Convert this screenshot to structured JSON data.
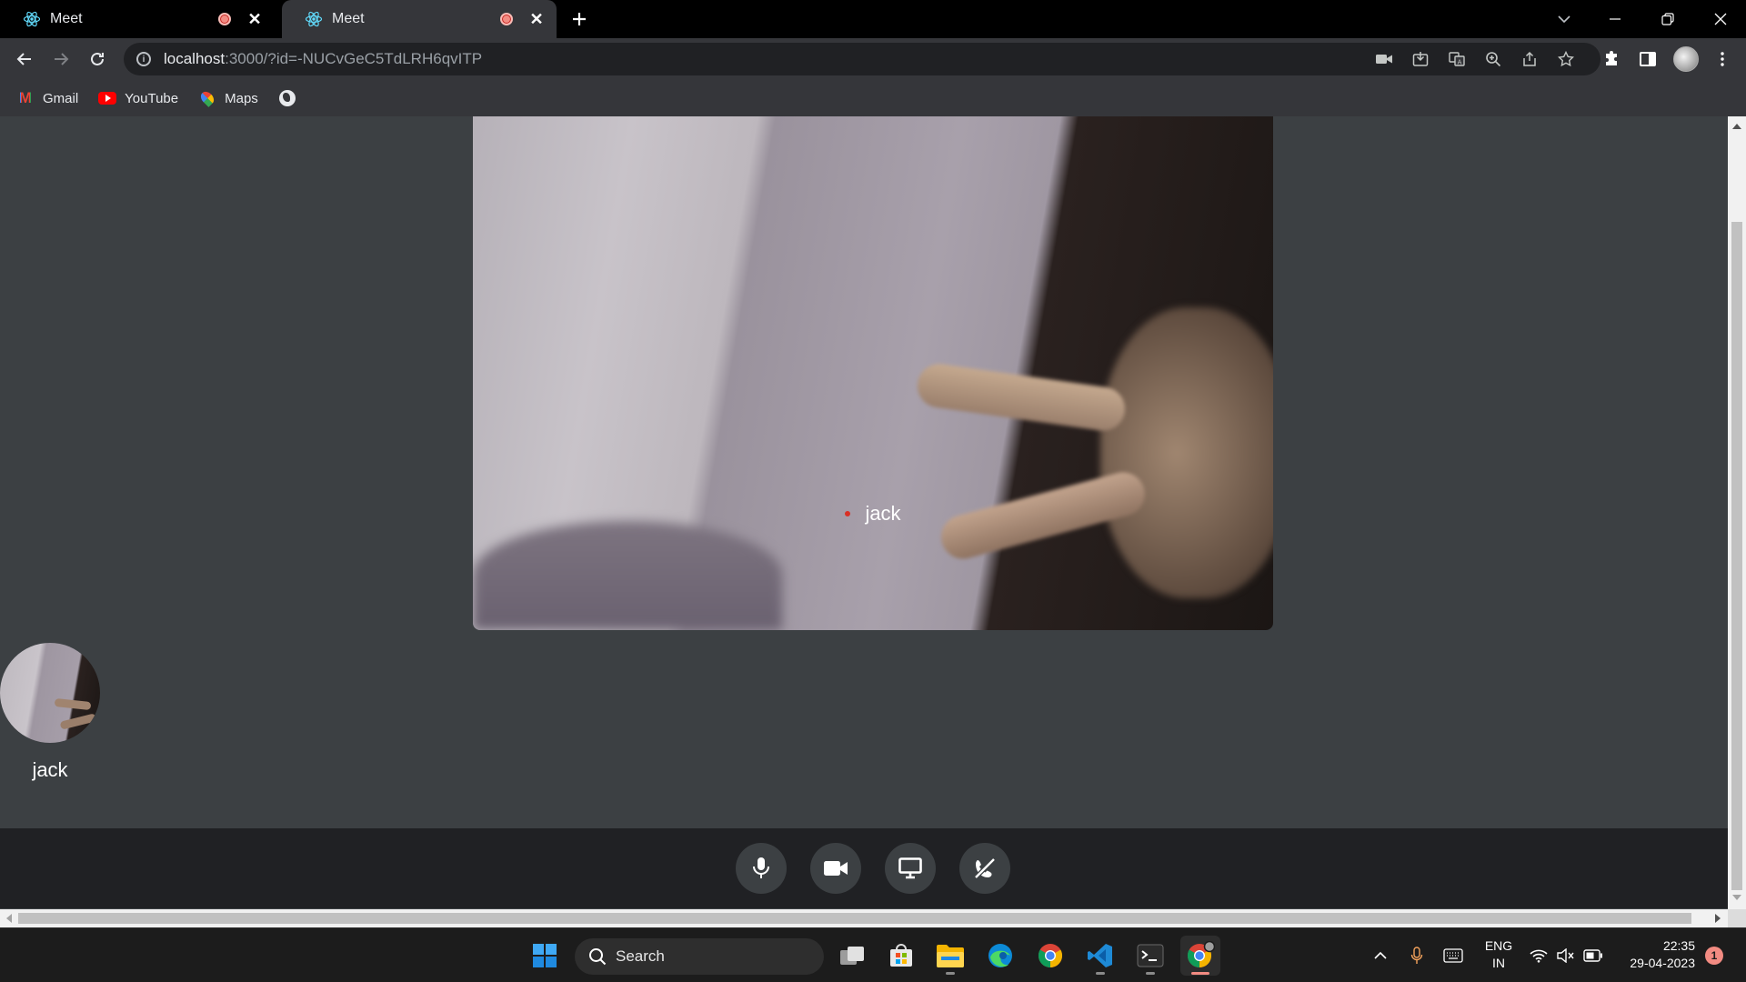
{
  "browser": {
    "tabs": [
      {
        "title": "Meet",
        "recording": true,
        "active": false
      },
      {
        "title": "Meet",
        "recording": true,
        "active": true
      }
    ],
    "new_tab_icon": "plus-icon",
    "address": {
      "host": "localhost",
      "rest": ":3000/?id=-NUCvGeC5TdLRH6qvITP"
    },
    "bookmarks": [
      {
        "label": "Gmail",
        "icon": "gmail-icon"
      },
      {
        "label": "YouTube",
        "icon": "youtube-icon"
      },
      {
        "label": "Maps",
        "icon": "maps-icon"
      },
      {
        "label": "",
        "icon": "globe-icon"
      }
    ]
  },
  "meeting": {
    "main_video": {
      "participant_name": "jack",
      "speaking_indicator_color": "#d93025"
    },
    "participants": [
      {
        "name": "jack"
      }
    ],
    "controls": [
      {
        "name": "microphone",
        "icon": "microphone-icon"
      },
      {
        "name": "camera",
        "icon": "video-camera-icon"
      },
      {
        "name": "screen-share",
        "icon": "monitor-icon"
      },
      {
        "name": "leave-call",
        "icon": "end-call-icon"
      }
    ]
  },
  "taskbar": {
    "search_label": "Search",
    "language": {
      "line1": "ENG",
      "line2": "IN"
    },
    "clock": {
      "time": "22:35",
      "date": "29-04-2023"
    },
    "notification_count": "1"
  },
  "colors": {
    "page_bg": "#3c4043",
    "controls_bg": "#202124",
    "control_button_bg": "#3c4043",
    "tab_bar_bg": "#000000",
    "toolbar_bg": "#35363a",
    "recording_dot": "#f28b82"
  }
}
